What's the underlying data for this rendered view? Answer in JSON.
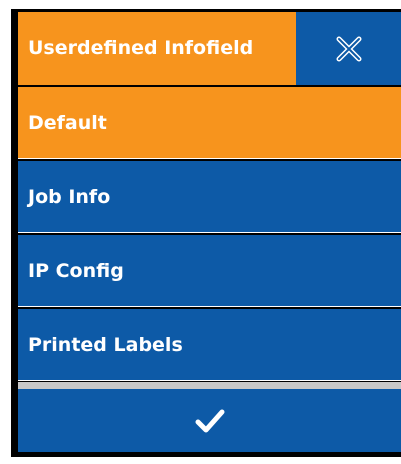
{
  "dialog": {
    "title": "Userdefined Infofield",
    "close_icon": "close-x-icon",
    "confirm_icon": "checkmark-icon"
  },
  "options": [
    {
      "label": "Default",
      "selected": true
    },
    {
      "label": "Job Info",
      "selected": false
    },
    {
      "label": "IP Config",
      "selected": false
    },
    {
      "label": "Printed Labels",
      "selected": false
    }
  ],
  "colors": {
    "accent_orange": "#f7941d",
    "primary_blue": "#0d5aa7",
    "text": "#ffffff",
    "separator": "#c8c8c8"
  }
}
